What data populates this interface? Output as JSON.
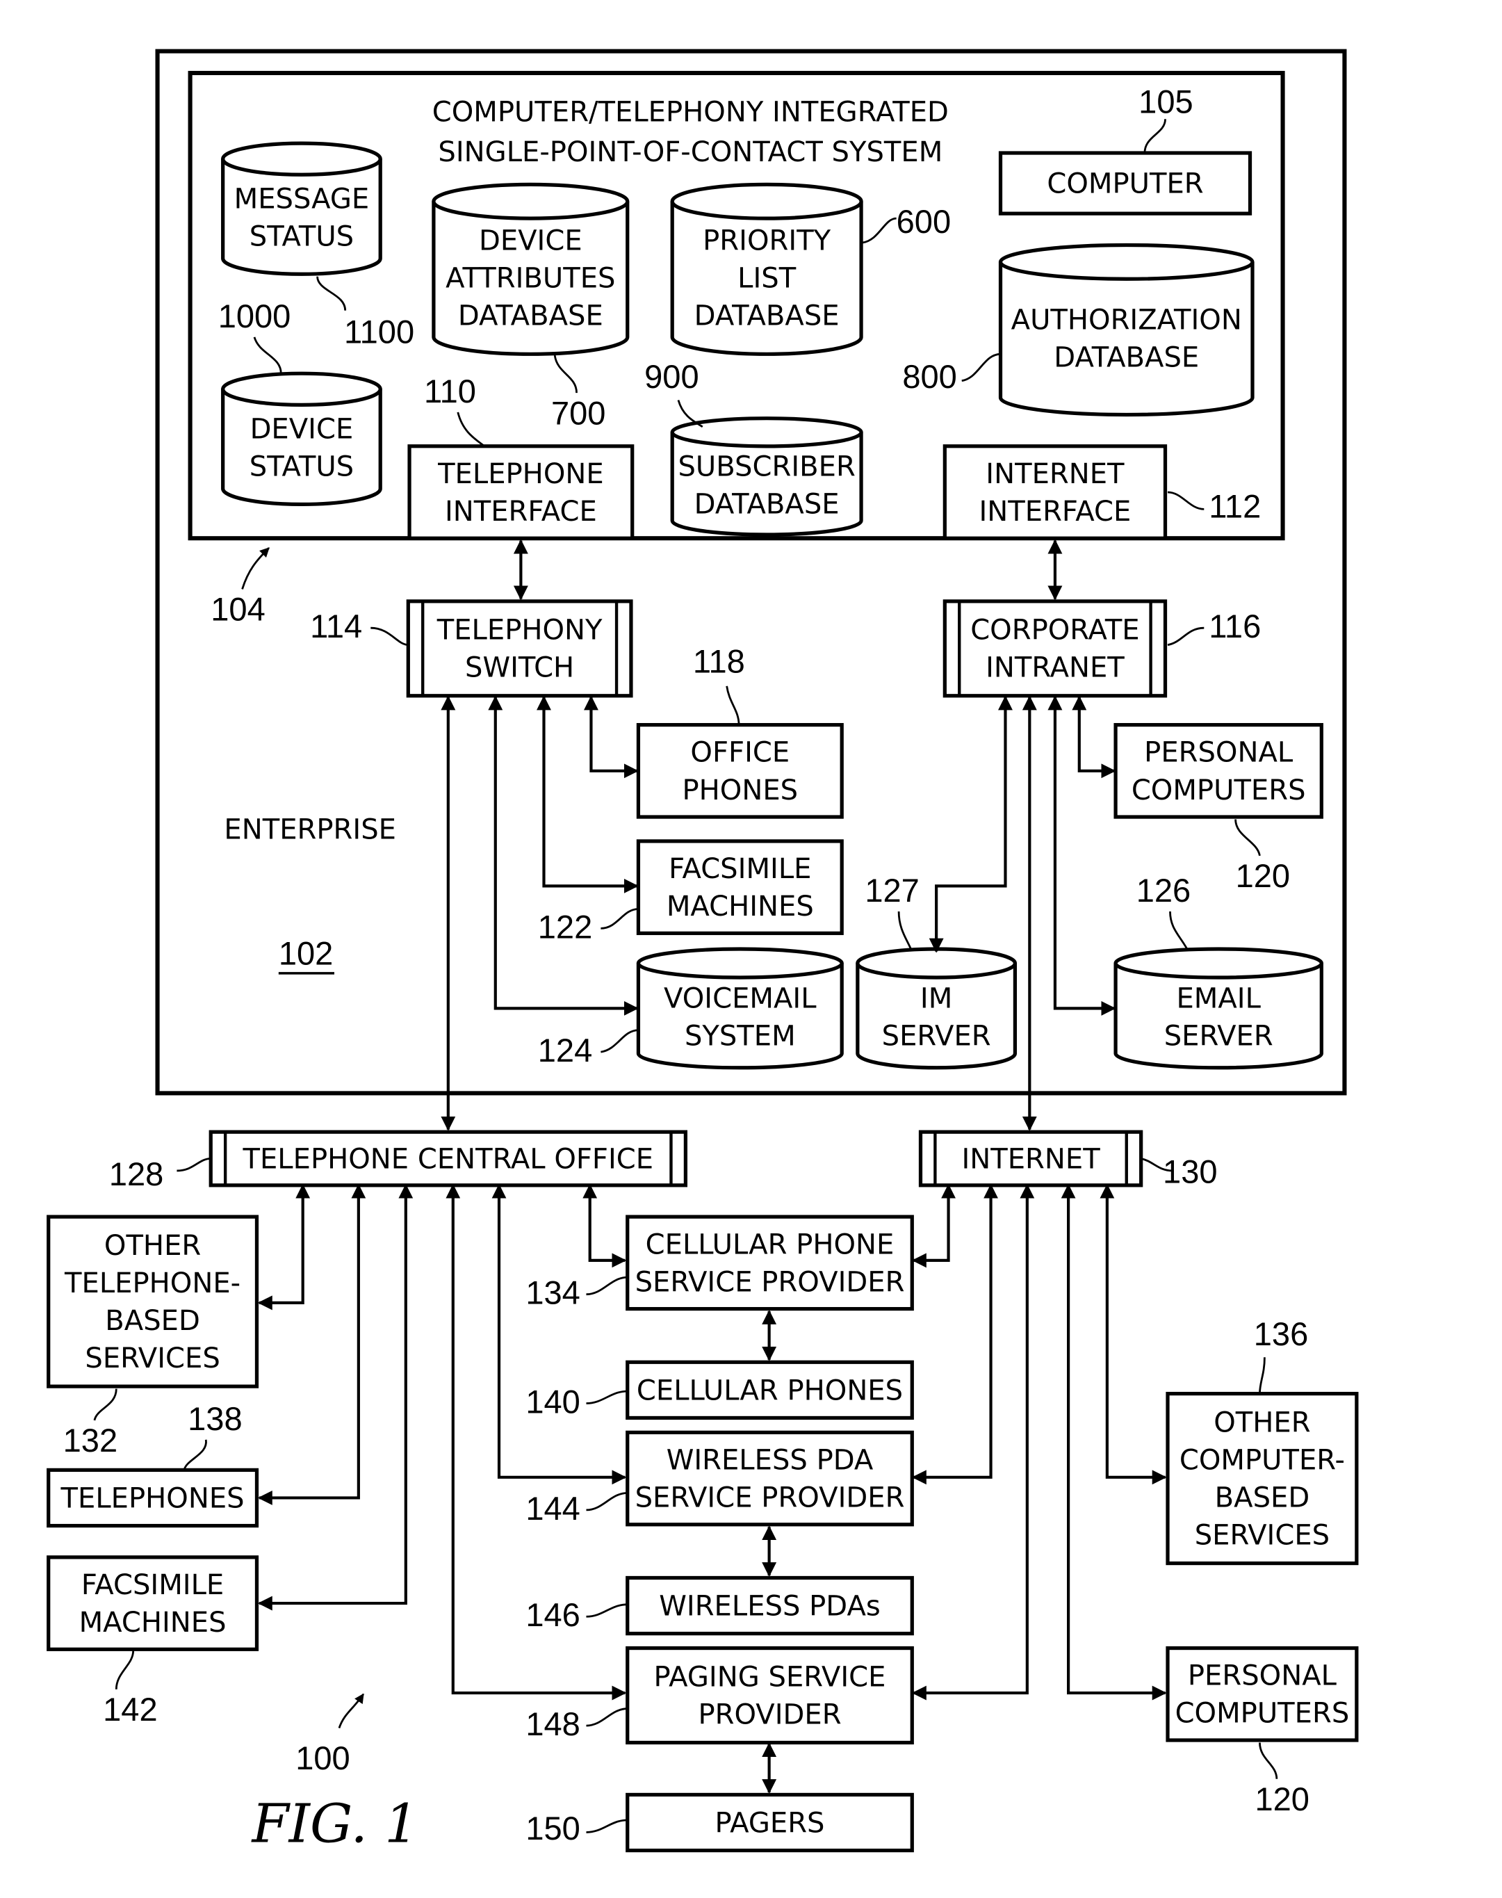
{
  "figure": {
    "caption": "FIG. 1",
    "system_ref": "100"
  },
  "enterprise": {
    "label": "ENTERPRISE",
    "ref": "102"
  },
  "cti_system": {
    "title_line1": "COMPUTER/TELEPHONY INTEGRATED",
    "title_line2": "SINGLE-POINT-OF-CONTACT SYSTEM",
    "ref": "104"
  },
  "nodes": {
    "message_status": {
      "lines": [
        "MESSAGE",
        "STATUS"
      ],
      "ref": "1100",
      "shape": "cylinder"
    },
    "device_status": {
      "lines": [
        "DEVICE",
        "STATUS"
      ],
      "ref": "1000",
      "shape": "cylinder"
    },
    "device_attributes_db": {
      "lines": [
        "DEVICE",
        "ATTRIBUTES",
        "DATABASE"
      ],
      "ref": "700",
      "shape": "cylinder"
    },
    "priority_list_db": {
      "lines": [
        "PRIORITY",
        "LIST",
        "DATABASE"
      ],
      "ref": "600",
      "shape": "cylinder"
    },
    "computer": {
      "lines": [
        "COMPUTER"
      ],
      "ref": "105",
      "shape": "box"
    },
    "authorization_db": {
      "lines": [
        "AUTHORIZATION",
        "DATABASE"
      ],
      "ref": "800",
      "shape": "cylinder"
    },
    "subscriber_db": {
      "lines": [
        "SUBSCRIBER",
        "DATABASE"
      ],
      "ref": "900",
      "shape": "cylinder"
    },
    "telephone_interface": {
      "lines": [
        "TELEPHONE",
        "INTERFACE"
      ],
      "ref": "110",
      "shape": "box"
    },
    "internet_interface": {
      "lines": [
        "INTERNET",
        "INTERFACE"
      ],
      "ref": "112",
      "shape": "box"
    },
    "telephony_switch": {
      "lines": [
        "TELEPHONY",
        "SWITCH"
      ],
      "ref": "114",
      "shape": "bus"
    },
    "corporate_intranet": {
      "lines": [
        "CORPORATE",
        "INTRANET"
      ],
      "ref": "116",
      "shape": "bus"
    },
    "office_phones": {
      "lines": [
        "OFFICE",
        "PHONES"
      ],
      "ref": "118",
      "shape": "box"
    },
    "enterprise_pcs": {
      "lines": [
        "PERSONAL",
        "COMPUTERS"
      ],
      "ref": "120",
      "shape": "box"
    },
    "enterprise_fax": {
      "lines": [
        "FACSIMILE",
        "MACHINES"
      ],
      "ref": "122",
      "shape": "box"
    },
    "voicemail": {
      "lines": [
        "VOICEMAIL",
        "SYSTEM"
      ],
      "ref": "124",
      "shape": "cylinder"
    },
    "im_server": {
      "lines": [
        "IM",
        "SERVER"
      ],
      "ref": "127",
      "shape": "cylinder"
    },
    "email_server": {
      "lines": [
        "EMAIL",
        "SERVER"
      ],
      "ref": "126",
      "shape": "cylinder"
    },
    "telephone_central_office": {
      "lines": [
        "TELEPHONE CENTRAL OFFICE"
      ],
      "ref": "128",
      "shape": "bus"
    },
    "internet": {
      "lines": [
        "INTERNET"
      ],
      "ref": "130",
      "shape": "bus"
    },
    "other_telephone_services": {
      "lines": [
        "OTHER",
        "TELEPHONE-",
        "BASED",
        "SERVICES"
      ],
      "ref": "132",
      "shape": "box"
    },
    "telephones": {
      "lines": [
        "TELEPHONES"
      ],
      "ref": "138",
      "shape": "box"
    },
    "external_fax": {
      "lines": [
        "FACSIMILE",
        "MACHINES"
      ],
      "ref": "142",
      "shape": "box"
    },
    "cellular_provider": {
      "lines": [
        "CELLULAR PHONE",
        "SERVICE PROVIDER"
      ],
      "ref": "134",
      "shape": "box"
    },
    "cellular_phones": {
      "lines": [
        "CELLULAR PHONES"
      ],
      "ref": "140",
      "shape": "box"
    },
    "wireless_pda_provider": {
      "lines": [
        "WIRELESS PDA",
        "SERVICE PROVIDER"
      ],
      "ref": "144",
      "shape": "box"
    },
    "wireless_pdas": {
      "lines": [
        "WIRELESS PDAs"
      ],
      "ref": "146",
      "shape": "box"
    },
    "paging_provider": {
      "lines": [
        "PAGING SERVICE",
        "PROVIDER"
      ],
      "ref": "148",
      "shape": "box"
    },
    "pagers": {
      "lines": [
        "PAGERS"
      ],
      "ref": "150",
      "shape": "box"
    },
    "other_computer_services": {
      "lines": [
        "OTHER",
        "COMPUTER-",
        "BASED",
        "SERVICES"
      ],
      "ref": "136",
      "shape": "box"
    },
    "external_pcs": {
      "lines": [
        "PERSONAL",
        "COMPUTERS"
      ],
      "ref": "120",
      "shape": "box"
    }
  },
  "connections": [
    [
      "telephone_interface",
      "telephony_switch"
    ],
    [
      "internet_interface",
      "corporate_intranet"
    ],
    [
      "telephony_switch",
      "office_phones"
    ],
    [
      "telephony_switch",
      "enterprise_fax"
    ],
    [
      "telephony_switch",
      "voicemail"
    ],
    [
      "telephony_switch",
      "telephone_central_office"
    ],
    [
      "corporate_intranet",
      "enterprise_pcs"
    ],
    [
      "corporate_intranet",
      "im_server"
    ],
    [
      "corporate_intranet",
      "email_server"
    ],
    [
      "corporate_intranet",
      "internet"
    ],
    [
      "telephone_central_office",
      "other_telephone_services"
    ],
    [
      "telephone_central_office",
      "telephones"
    ],
    [
      "telephone_central_office",
      "external_fax"
    ],
    [
      "telephone_central_office",
      "cellular_provider"
    ],
    [
      "telephone_central_office",
      "wireless_pda_provider"
    ],
    [
      "telephone_central_office",
      "paging_provider"
    ],
    [
      "internet",
      "cellular_provider"
    ],
    [
      "internet",
      "wireless_pda_provider"
    ],
    [
      "internet",
      "paging_provider"
    ],
    [
      "internet",
      "other_computer_services"
    ],
    [
      "internet",
      "external_pcs"
    ],
    [
      "cellular_provider",
      "cellular_phones"
    ],
    [
      "wireless_pda_provider",
      "wireless_pdas"
    ],
    [
      "paging_provider",
      "pagers"
    ]
  ]
}
